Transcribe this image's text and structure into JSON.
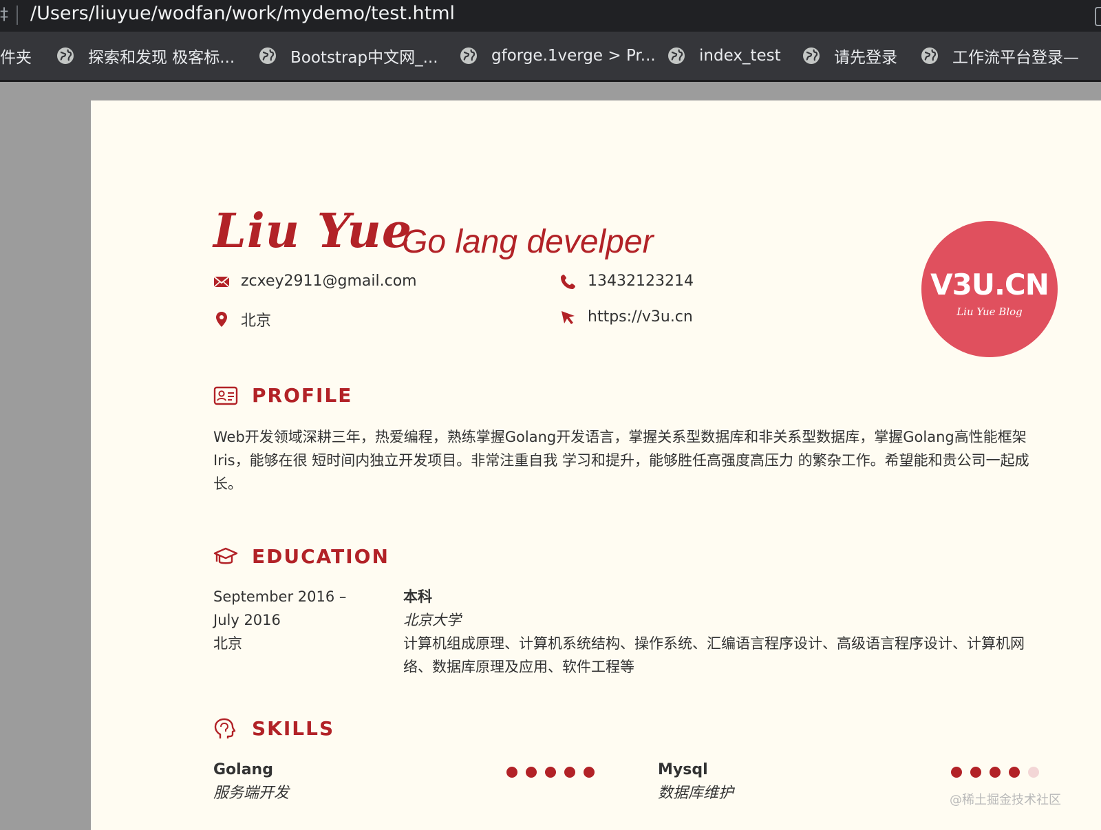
{
  "browser": {
    "cut_glyph": "‡",
    "url": "/Users/liuyue/wodfan/work/mydemo/test.html",
    "bookmarks": [
      {
        "label": "件夹",
        "icon": "none"
      },
      {
        "label": "探索和发现 极客标...",
        "icon": "globe-icon"
      },
      {
        "label": "Bootstrap中文网_...",
        "icon": "globe-icon"
      },
      {
        "label": "gforge.1verge > Pr...",
        "icon": "globe-icon"
      },
      {
        "label": "index_test",
        "icon": "globe-icon"
      },
      {
        "label": "请先登录",
        "icon": "globe-icon"
      },
      {
        "label": "工作流平台登录—",
        "icon": "globe-icon"
      }
    ]
  },
  "resume": {
    "name": "Liu Yue",
    "role": "Go lang develper",
    "contacts": {
      "email": "zcxey2911@gmail.com",
      "phone": "13432123214",
      "location": "北京",
      "website": "https://v3u.cn"
    },
    "logo": {
      "main": "V3U.CN",
      "sub": "Liu Yue Blog",
      "color": "#e0505e"
    },
    "profile": {
      "title": "PROFILE",
      "text": "Web开发领域深耕三年，热爱编程，熟练掌握Golang开发语言，掌握关系型数据库和非关系型数据库，掌握Golang高性能框架Iris，能够在很 短时间内独立开发项目。非常注重自我 学习和提升，能够胜任高强度高压力 的繁杂工作。希望能和贵公司一起成长。"
    },
    "education": {
      "title": "EDUCATION",
      "date_start": "September 2016 –",
      "date_end": "July 2016",
      "location": "北京",
      "degree": "本科",
      "school": "北京大学",
      "courses": "计算机组成原理、计算机系统结构、操作系统、汇编语言程序设计、高级语言程序设计、计算机网络、数据库原理及应用、软件工程等"
    },
    "skills": {
      "title": "SKILLS",
      "items": [
        {
          "name": "Golang",
          "desc": "服务端开发",
          "level": 5,
          "max": 5
        },
        {
          "name": "Mysql",
          "desc": "数据库维护",
          "level": 4,
          "max": 5
        }
      ]
    },
    "watermark": "@稀土掘金技术社区"
  },
  "colors": {
    "accent": "#b22227",
    "page_bg": "#fffcf2",
    "chrome": "#202124",
    "bookmark_bar": "#35363a"
  }
}
